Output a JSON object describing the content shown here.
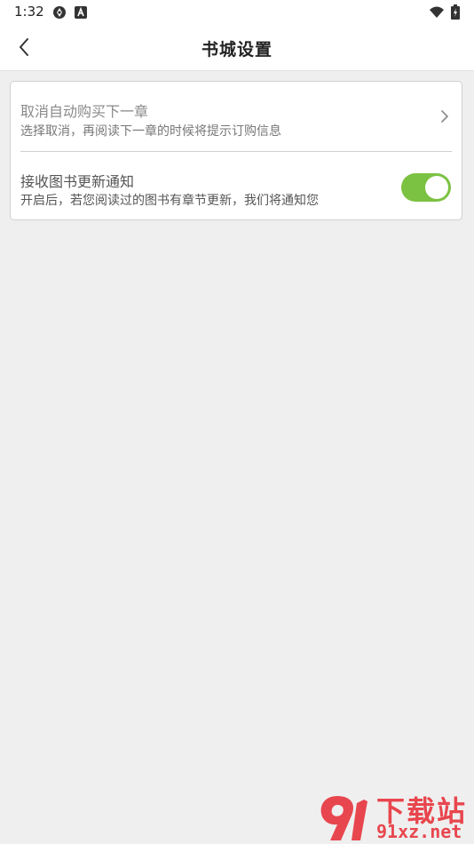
{
  "status_bar": {
    "time": "1:32",
    "left_icons": [
      "drive-icon",
      "text-badge-icon"
    ],
    "right_icons": [
      "wifi-icon",
      "battery-charging-icon"
    ]
  },
  "header": {
    "title": "书城设置",
    "back_icon": "chevron-left-icon"
  },
  "settings": {
    "auto_buy": {
      "title": "取消自动购买下一章",
      "description": "选择取消，再阅读下一章的时候将提示订购信息",
      "icon": "chevron-right-icon"
    },
    "update_notify": {
      "title": "接收图书更新通知",
      "description": "开启后，若您阅读过的图书有章节更新，我们将通知您",
      "enabled": true
    }
  },
  "watermark": {
    "logo_text": "9",
    "chinese_text": "下载站",
    "url_text": "91xz.net"
  },
  "colors": {
    "toggle_on": "#7cc242",
    "background": "#efefef",
    "watermark": "#e8464e"
  }
}
